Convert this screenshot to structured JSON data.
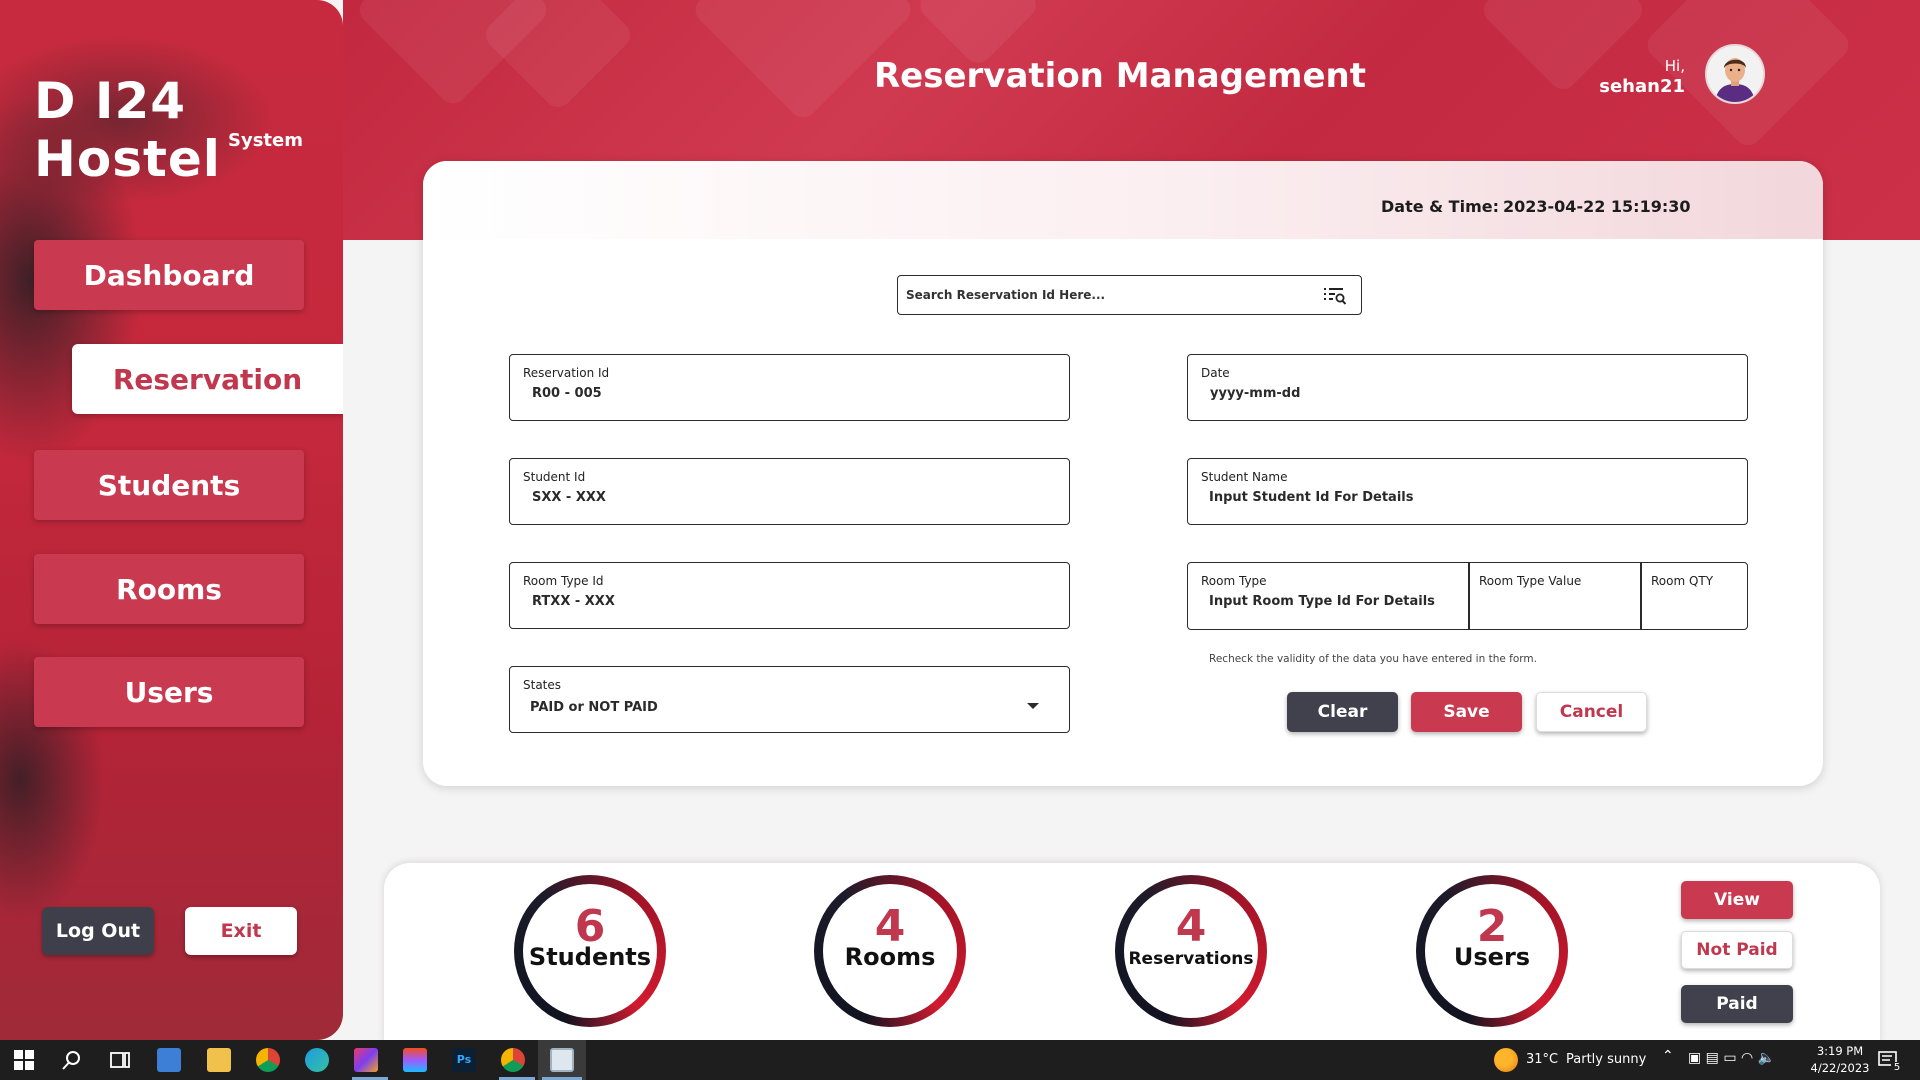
{
  "app": {
    "brand_title": "D I24 Hostel",
    "brand_subtitle": "System",
    "page_title": "Reservation Management",
    "greeting": "Hi,",
    "username": "sehan21"
  },
  "sidebar": {
    "items": [
      {
        "label": "Dashboard",
        "active": false
      },
      {
        "label": "Reservation",
        "active": true
      },
      {
        "label": "Students",
        "active": false
      },
      {
        "label": "Rooms",
        "active": false
      },
      {
        "label": "Users",
        "active": false
      }
    ],
    "logout_label": "Log Out",
    "exit_label": "Exit"
  },
  "datetime": {
    "label": "Date & Time:",
    "value": "2023-04-22 15:19:30"
  },
  "search": {
    "placeholder": "Search Reservation Id Here..."
  },
  "form": {
    "reservation_id": {
      "label": "Reservation Id",
      "value": "R00 - 005"
    },
    "date": {
      "label": "Date",
      "value": "yyyy-mm-dd"
    },
    "student_id": {
      "label": "Student Id",
      "value": "SXX - XXX"
    },
    "student_name": {
      "label": "Student Name",
      "value": "Input Student Id For Details"
    },
    "room_type_id": {
      "label": "Room Type Id",
      "value": "RTXX - XXX"
    },
    "room_type": {
      "label": "Room Type",
      "value": "Input Room Type Id For Details"
    },
    "room_type_value": {
      "label": "Room Type Value",
      "value": ""
    },
    "room_qty": {
      "label": "Room QTY",
      "value": ""
    },
    "states": {
      "label": "States",
      "value": "PAID or NOT PAID"
    },
    "hint": "Recheck the validity of the data you have entered in the form."
  },
  "actions": {
    "clear": "Clear",
    "save": "Save",
    "cancel": "Cancel"
  },
  "stats": [
    {
      "count": "6",
      "label": "Students"
    },
    {
      "count": "4",
      "label": "Rooms"
    },
    {
      "count": "4",
      "label": "Reservations"
    },
    {
      "count": "2",
      "label": "Users"
    }
  ],
  "filters": {
    "view": "View",
    "not_paid": "Not Paid",
    "paid": "Paid"
  },
  "taskbar": {
    "weather_temp": "31°C",
    "weather_desc": "Partly sunny",
    "time": "3:19 PM",
    "date": "4/22/2023",
    "notification_count": "5"
  },
  "colors": {
    "accent": "#c9394f",
    "dark_button": "#41414d",
    "header": "#c2283f"
  }
}
